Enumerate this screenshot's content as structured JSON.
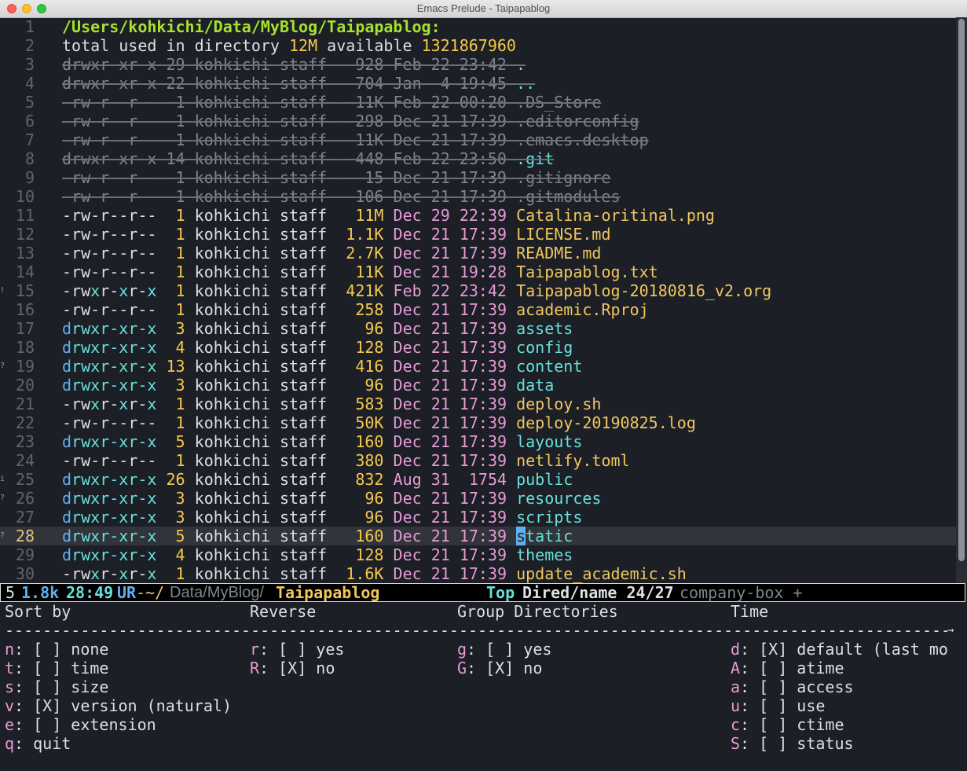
{
  "window": {
    "title": "Emacs Prelude - Taipapablog"
  },
  "buffer": {
    "header_path": "/Users/kohkichi/Data/MyBlog/Taipapablog:",
    "total_line": {
      "prefix": "total used in directory ",
      "used": "12M",
      "mid": " available ",
      "available": "1321867960"
    },
    "rows": [
      {
        "perms": "drwxr-xr-x",
        "links": "29",
        "owner": "kohkichi",
        "group": "staff",
        "size": "928",
        "date": "Feb 22 23:42",
        "name": ".",
        "kind": "dotdir"
      },
      {
        "perms": "drwxr-xr-x",
        "links": "22",
        "owner": "kohkichi",
        "group": "staff",
        "size": "704",
        "date": "Jan  4 19:45",
        "name": "..",
        "kind": "dotdir"
      },
      {
        "perms": "-rw-r--r--",
        "links": "1",
        "owner": "kohkichi",
        "group": "staff",
        "size": "11K",
        "date": "Feb 22 00:20",
        "name": ".DS_Store",
        "kind": "hidden"
      },
      {
        "perms": "-rw-r--r--",
        "links": "1",
        "owner": "kohkichi",
        "group": "staff",
        "size": "298",
        "date": "Dec 21 17:39",
        "name": ".editorconfig",
        "kind": "hidden"
      },
      {
        "perms": "-rw-r--r--",
        "links": "1",
        "owner": "kohkichi",
        "group": "staff",
        "size": "11K",
        "date": "Dec 21 17:39",
        "name": ".emacs.desktop",
        "kind": "hidden"
      },
      {
        "perms": "drwxr-xr-x",
        "links": "14",
        "owner": "kohkichi",
        "group": "staff",
        "size": "448",
        "date": "Feb 22 23:50",
        "name": ".git",
        "kind": "dotdir"
      },
      {
        "perms": "-rw-r--r--",
        "links": "1",
        "owner": "kohkichi",
        "group": "staff",
        "size": "15",
        "date": "Dec 21 17:39",
        "name": ".gitignore",
        "kind": "hidden"
      },
      {
        "perms": "-rw-r--r--",
        "links": "1",
        "owner": "kohkichi",
        "group": "staff",
        "size": "106",
        "date": "Dec 21 17:39",
        "name": ".gitmodules",
        "kind": "hidden"
      },
      {
        "perms": "-rw-r--r--",
        "links": "1",
        "owner": "kohkichi",
        "group": "staff",
        "size": "11M",
        "date": "Dec 29 22:39",
        "name": "Catalina-oritinal.png",
        "kind": "file"
      },
      {
        "perms": "-rw-r--r--",
        "links": "1",
        "owner": "kohkichi",
        "group": "staff",
        "size": "1.1K",
        "date": "Dec 21 17:39",
        "name": "LICENSE.md",
        "kind": "file"
      },
      {
        "perms": "-rw-r--r--",
        "links": "1",
        "owner": "kohkichi",
        "group": "staff",
        "size": "2.7K",
        "date": "Dec 21 17:39",
        "name": "README.md",
        "kind": "file"
      },
      {
        "perms": "-rw-r--r--",
        "links": "1",
        "owner": "kohkichi",
        "group": "staff",
        "size": "11K",
        "date": "Dec 21 19:28",
        "name": "Taipapablog.txt",
        "kind": "file"
      },
      {
        "perms": "-rwxr-xr-x",
        "links": "1",
        "owner": "kohkichi",
        "group": "staff",
        "size": "421K",
        "date": "Feb 22 23:42",
        "name": "Taipapablog-20180816_v2.org",
        "kind": "file"
      },
      {
        "perms": "-rw-r--r--",
        "links": "1",
        "owner": "kohkichi",
        "group": "staff",
        "size": "258",
        "date": "Dec 21 17:39",
        "name": "academic.Rproj",
        "kind": "file"
      },
      {
        "perms": "drwxr-xr-x",
        "links": "3",
        "owner": "kohkichi",
        "group": "staff",
        "size": "96",
        "date": "Dec 21 17:39",
        "name": "assets",
        "kind": "dir"
      },
      {
        "perms": "drwxr-xr-x",
        "links": "4",
        "owner": "kohkichi",
        "group": "staff",
        "size": "128",
        "date": "Dec 21 17:39",
        "name": "config",
        "kind": "dir"
      },
      {
        "perms": "drwxr-xr-x",
        "links": "13",
        "owner": "kohkichi",
        "group": "staff",
        "size": "416",
        "date": "Dec 21 17:39",
        "name": "content",
        "kind": "dir"
      },
      {
        "perms": "drwxr-xr-x",
        "links": "3",
        "owner": "kohkichi",
        "group": "staff",
        "size": "96",
        "date": "Dec 21 17:39",
        "name": "data",
        "kind": "dir"
      },
      {
        "perms": "-rwxr-xr-x",
        "links": "1",
        "owner": "kohkichi",
        "group": "staff",
        "size": "583",
        "date": "Dec 21 17:39",
        "name": "deploy.sh",
        "kind": "file"
      },
      {
        "perms": "-rw-r--r--",
        "links": "1",
        "owner": "kohkichi",
        "group": "staff",
        "size": "50K",
        "date": "Dec 21 17:39",
        "name": "deploy-20190825.log",
        "kind": "file"
      },
      {
        "perms": "drwxr-xr-x",
        "links": "5",
        "owner": "kohkichi",
        "group": "staff",
        "size": "160",
        "date": "Dec 21 17:39",
        "name": "layouts",
        "kind": "dir"
      },
      {
        "perms": "-rw-r--r--",
        "links": "1",
        "owner": "kohkichi",
        "group": "staff",
        "size": "380",
        "date": "Dec 21 17:39",
        "name": "netlify.toml",
        "kind": "file"
      },
      {
        "perms": "drwxr-xr-x",
        "links": "26",
        "owner": "kohkichi",
        "group": "staff",
        "size": "832",
        "date": "Aug 31  1754",
        "name": "public",
        "kind": "dir"
      },
      {
        "perms": "drwxr-xr-x",
        "links": "3",
        "owner": "kohkichi",
        "group": "staff",
        "size": "96",
        "date": "Dec 21 17:39",
        "name": "resources",
        "kind": "dir"
      },
      {
        "perms": "drwxr-xr-x",
        "links": "3",
        "owner": "kohkichi",
        "group": "staff",
        "size": "96",
        "date": "Dec 21 17:39",
        "name": "scripts",
        "kind": "dir"
      },
      {
        "perms": "drwxr-xr-x",
        "links": "5",
        "owner": "kohkichi",
        "group": "staff",
        "size": "160",
        "date": "Dec 21 17:39",
        "name": "static",
        "kind": "dir",
        "current": true
      },
      {
        "perms": "drwxr-xr-x",
        "links": "4",
        "owner": "kohkichi",
        "group": "staff",
        "size": "128",
        "date": "Dec 21 17:39",
        "name": "themes",
        "kind": "dir"
      },
      {
        "perms": "-rwxr-xr-x",
        "links": "1",
        "owner": "kohkichi",
        "group": "staff",
        "size": "1.6K",
        "date": "Dec 21 17:39",
        "name": "update_academic.sh",
        "kind": "file"
      }
    ],
    "line_numbers": [
      "1",
      "2",
      "3",
      "4",
      "5",
      "6",
      "7",
      "8",
      "9",
      "10",
      "11",
      "12",
      "13",
      "14",
      "15",
      "16",
      "17",
      "18",
      "19",
      "20",
      "21",
      "22",
      "23",
      "24",
      "25",
      "26",
      "27",
      "28",
      "29",
      "30"
    ],
    "fringe_marks": {
      "15": "!",
      "19": "?",
      "25": "i",
      "26": "?",
      "28": "?"
    }
  },
  "modeline": {
    "window_num": "5",
    "size": "1.8k",
    "position": "28:49",
    "state": "UR",
    "path_prefix": "-~/",
    "path_mid": "Data/MyBlog/",
    "buffer_name": "Taipapablog",
    "top": "Top",
    "mode": "Dired/name 24/27",
    "minor": "company-box +"
  },
  "transient": {
    "columns": [
      {
        "heading": "Sort by",
        "options": [
          {
            "key": "n",
            "box": "[ ]",
            "label": "none"
          },
          {
            "key": "t",
            "box": "[ ]",
            "label": "time"
          },
          {
            "key": "s",
            "box": "[ ]",
            "label": "size"
          },
          {
            "key": "v",
            "box": "[X]",
            "label": "version (natural)"
          },
          {
            "key": "e",
            "box": "[ ]",
            "label": "extension"
          },
          {
            "key": "q",
            "box": "",
            "label": "quit"
          }
        ]
      },
      {
        "heading": "Reverse",
        "options": [
          {
            "key": "r",
            "box": "[ ]",
            "label": "yes"
          },
          {
            "key": "R",
            "box": "[X]",
            "label": "no"
          }
        ]
      },
      {
        "heading": "Group Directories",
        "options": [
          {
            "key": "g",
            "box": "[ ]",
            "label": "yes"
          },
          {
            "key": "G",
            "box": "[X]",
            "label": "no"
          }
        ]
      },
      {
        "heading": "Time",
        "options": [
          {
            "key": "d",
            "box": "[X]",
            "label": "default (last mo"
          },
          {
            "key": "A",
            "box": "[ ]",
            "label": "atime"
          },
          {
            "key": "a",
            "box": "[ ]",
            "label": "access"
          },
          {
            "key": "u",
            "box": "[ ]",
            "label": "use"
          },
          {
            "key": "c",
            "box": "[ ]",
            "label": "ctime"
          },
          {
            "key": "S",
            "box": "[ ]",
            "label": "status"
          }
        ]
      }
    ],
    "separator_end": "→"
  },
  "colors": {
    "background": "#1c1f26",
    "directory": "#66e1dc",
    "file": "#f0c75e",
    "size": "#f5c84c",
    "date": "#e79ad7",
    "header": "#a6e22e"
  }
}
